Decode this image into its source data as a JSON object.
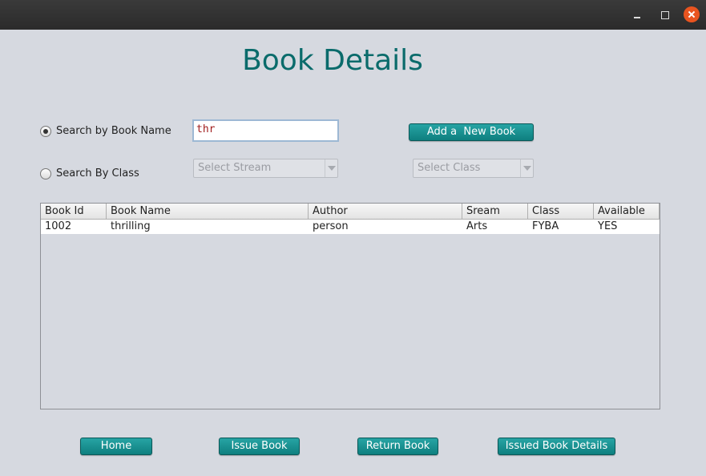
{
  "title": "Book Details",
  "search": {
    "by_name_label": "Search by Book Name",
    "by_class_label": "Search By Class",
    "name_value": "thr",
    "by_name_selected": true
  },
  "add_book_label": "Add a  New Book",
  "stream_select": {
    "value": "Select Stream"
  },
  "class_select": {
    "value": "Select Class"
  },
  "table": {
    "headers": [
      "Book Id",
      "Book Name",
      "Author",
      "Sream",
      "Class",
      "Available"
    ],
    "rows": [
      [
        "1002",
        "thrilling",
        "person",
        "Arts",
        "FYBA",
        "YES"
      ]
    ]
  },
  "buttons": {
    "home": "Home",
    "issue": "Issue Book",
    "return": "Return Book",
    "issued_details": "Issued Book Details"
  },
  "colors": {
    "accent": "#0e7f7f",
    "title": "#0a6b6b",
    "close": "#e9541f"
  }
}
